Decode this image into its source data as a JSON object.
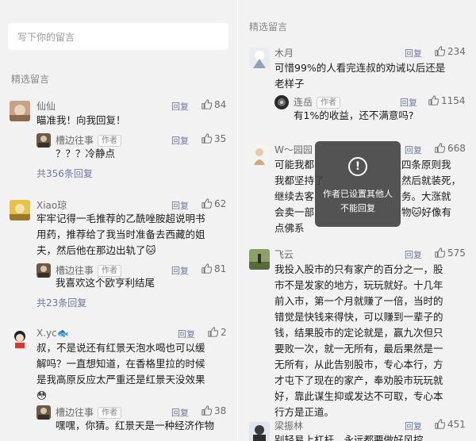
{
  "left": {
    "input_placeholder": "写下你的留言",
    "section_title": "精选留言",
    "comments": [
      {
        "name": "仙仙",
        "reply": "回复",
        "likes": "84",
        "lines": [
          "瞄准我！向我回复！"
        ],
        "author_reply": {
          "name": "槽边往事",
          "tag": "作者",
          "reply": "回复",
          "likes": "35",
          "text": "？？？冷静点"
        },
        "more": "共356条回复"
      },
      {
        "name": "Xiao琼",
        "reply": "回复",
        "likes": "62",
        "lines": [
          "牢牢记得一毛推荐的乙酰唑胺超说明书",
          "用药，推荐给了我当时准备去西藏的姐",
          "夫，然后他在那边出轨了🐱"
        ],
        "author_reply": {
          "name": "槽边往事",
          "tag": "作者",
          "reply": "回复",
          "likes": "81",
          "text": "我喜欢这个欧亨利结尾"
        },
        "more": "共23条回复"
      },
      {
        "name": "X.yc🐟",
        "reply": "回复",
        "likes": "2",
        "lines": [
          "叔，不是说还有红景天泡水喝也可以缓",
          "解吗？一直想知道，在香格里拉的时候",
          "是我高原反应太严重还是红景天没效果",
          "😳"
        ],
        "author_reply": {
          "name": "槽边往事",
          "tag": "作者",
          "reply": "回复",
          "likes": "38",
          "text": "嘿嘿，你猜。红景天是一种经济作物"
        }
      }
    ]
  },
  "right": {
    "section_title": "精选留言",
    "comments": [
      {
        "name": "木月",
        "reply": "回复",
        "likes": "234",
        "lines": [
          "可惜99%的人看完连叔的劝诫以后还是",
          "老样子"
        ],
        "sub_reply": {
          "name": "连岳",
          "tag": "作者",
          "reply": "回复",
          "likes": "1154",
          "text": "有1%的收益，还不满意吗?"
        }
      },
      {
        "name": "W～园园",
        "reply": "回复",
        "likes": "668",
        "lines": [
          "可能我都",
          "四条原则我",
          "我都坚持了",
          "然后就装死，",
          "继续去客",
          "务。大涨就",
          "会卖一部",
          "物🐱好像有",
          "点佛系"
        ]
      },
      {
        "name": "飞云",
        "reply": "回复",
        "likes": "575",
        "lines": [
          "我投入股市的只有家产的百分之一，股",
          "市不是发家的地方，玩玩就好。十几年",
          "前入市，第一个月就赚了一倍，当时的",
          "错觉是快钱来得快，可以赚到一辈子的",
          "钱，结果股市的定论就是，赢九次但只",
          "要败一次，就一无所有，最后果然是一",
          "无所有，从此告别股市，专心本行，方",
          "才屯下了现在的家产，奉劝股市玩玩就",
          "好，靠此谋生抑或发达不可取，专心本",
          "行方是正道。"
        ]
      },
      {
        "name": "梁振林",
        "reply": "回复",
        "likes": "451",
        "lines": [
          "别轻易上杠杆，永远都要做好风控"
        ]
      }
    ],
    "toast": {
      "icon": "!",
      "message": "作者已设置其他人不能回复"
    }
  }
}
